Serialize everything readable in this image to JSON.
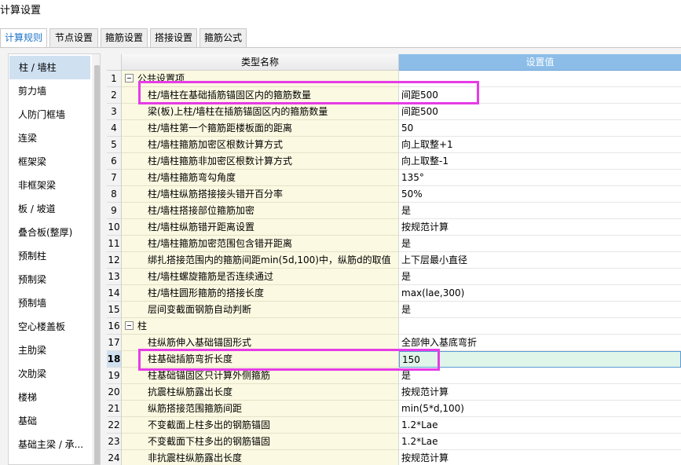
{
  "window": {
    "title": "计算设置"
  },
  "tabs": [
    {
      "label": "计算规则",
      "active": true
    },
    {
      "label": "节点设置",
      "active": false
    },
    {
      "label": "箍筋设置",
      "active": false
    },
    {
      "label": "搭接设置",
      "active": false
    },
    {
      "label": "箍筋公式",
      "active": false
    }
  ],
  "sidebar": {
    "items": [
      {
        "label": "柱 / 墙柱",
        "selected": true
      },
      {
        "label": "剪力墙"
      },
      {
        "label": "人防门框墙"
      },
      {
        "label": "连梁"
      },
      {
        "label": "框架梁"
      },
      {
        "label": "非框架梁"
      },
      {
        "label": "板 / 坡道"
      },
      {
        "label": "叠合板(整厚)"
      },
      {
        "label": "预制柱"
      },
      {
        "label": "预制梁"
      },
      {
        "label": "预制墙"
      },
      {
        "label": "空心楼盖板"
      },
      {
        "label": "主肋梁"
      },
      {
        "label": "次肋梁"
      },
      {
        "label": "楼梯"
      },
      {
        "label": "基础"
      },
      {
        "label": "基础主梁 / 承..."
      }
    ]
  },
  "grid": {
    "header_name": "类型名称",
    "header_value": "设置值",
    "rows": [
      {
        "num": "1",
        "name": "公共设置项",
        "value": "",
        "group": true
      },
      {
        "num": "2",
        "name": "柱/墙柱在基础插筋锚固区内的箍筋数量",
        "value": "间距500"
      },
      {
        "num": "3",
        "name": "梁(板)上柱/墙柱在插筋锚固区内的箍筋数量",
        "value": "间距500"
      },
      {
        "num": "4",
        "name": "柱/墙柱第一个箍筋距楼板面的距离",
        "value": "50"
      },
      {
        "num": "5",
        "name": "柱/墙柱箍筋加密区根数计算方式",
        "value": "向上取整+1"
      },
      {
        "num": "6",
        "name": "柱/墙柱箍筋非加密区根数计算方式",
        "value": "向上取整-1"
      },
      {
        "num": "7",
        "name": "柱/墙柱箍筋弯勾角度",
        "value": "135°"
      },
      {
        "num": "8",
        "name": "柱/墙柱纵筋搭接接头错开百分率",
        "value": "50%"
      },
      {
        "num": "9",
        "name": "柱/墙柱搭接部位箍筋加密",
        "value": "是"
      },
      {
        "num": "10",
        "name": "柱/墙柱纵筋错开距离设置",
        "value": "按规范计算"
      },
      {
        "num": "11",
        "name": "柱/墙柱箍筋加密范围包含错开距离",
        "value": "是"
      },
      {
        "num": "12",
        "name": "绑扎搭接范围内的箍筋间距min(5d,100)中，纵筋d的取值",
        "value": "上下层最小直径"
      },
      {
        "num": "13",
        "name": "柱/墙柱螺旋箍筋是否连续通过",
        "value": "是"
      },
      {
        "num": "14",
        "name": "柱/墙柱圆形箍筋的搭接长度",
        "value": "max(lae,300)"
      },
      {
        "num": "15",
        "name": "层间变截面钢筋自动判断",
        "value": "是"
      },
      {
        "num": "16",
        "name": "柱",
        "value": "",
        "group": true
      },
      {
        "num": "17",
        "name": "柱纵筋伸入基础锚固形式",
        "value": "全部伸入基底弯折"
      },
      {
        "num": "18",
        "name": "柱基础插筋弯折长度",
        "value": "150",
        "current": true
      },
      {
        "num": "19",
        "name": "柱基础锚固区只计算外侧箍筋",
        "value": "是"
      },
      {
        "num": "20",
        "name": "抗震柱纵筋露出长度",
        "value": "按规范计算"
      },
      {
        "num": "21",
        "name": "纵筋搭接范围箍筋间距",
        "value": "min(5*d,100)"
      },
      {
        "num": "22",
        "name": "不变截面上柱多出的钢筋锚固",
        "value": "1.2*Lae"
      },
      {
        "num": "23",
        "name": "不变截面下柱多出的钢筋锚固",
        "value": "1.2*Lae"
      },
      {
        "num": "24",
        "name": "非抗震柱纵筋露出长度",
        "value": "按规范计算"
      }
    ]
  },
  "colors": {
    "highlight": "#e63ce6",
    "active_tab_text": "#1e73c8",
    "value_header": "#8bbde8",
    "name_cell": "#fbf9e1"
  }
}
